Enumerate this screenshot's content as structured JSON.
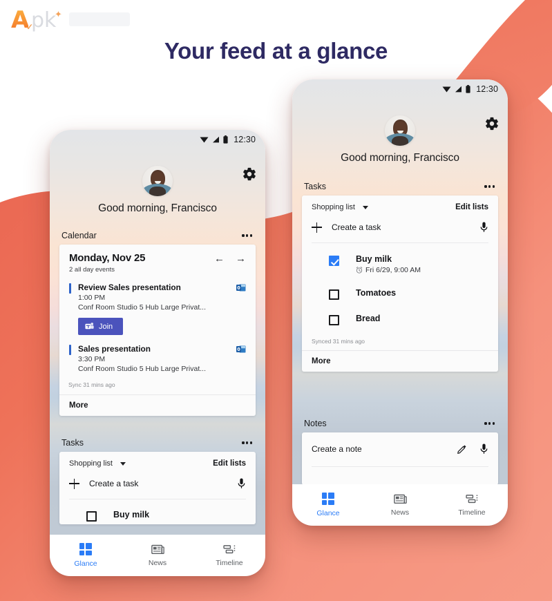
{
  "site": {
    "logo_a": "A",
    "logo_pk": "pk",
    "logo_star": "✦",
    "logo_check": "✓"
  },
  "page": {
    "title": "Your feed at a glance",
    "title_color": "#2e2a63",
    "background_coral": "#ee7259",
    "accent_blue": "#2b7cf6",
    "teams_purple": "#4b53bc",
    "event_bar_blue": "#2e63c9"
  },
  "status_bar": {
    "time": "12:30",
    "wifi_icon": "wifi-icon",
    "signal_icon": "signal-icon",
    "battery_icon": "battery-icon"
  },
  "header": {
    "settings_icon": "gear-icon",
    "avatar_icon": "avatar",
    "greeting": "Good morning, Francisco"
  },
  "left_phone": {
    "calendar_section": {
      "label": "Calendar",
      "overflow_icon": "more-options-icon",
      "date": "Monday, Nov 25",
      "subtitle": "2 all day events",
      "prev_icon": "arrow-left-icon",
      "next_icon": "arrow-right-icon",
      "prev_glyph": "←",
      "next_glyph": "→",
      "events": [
        {
          "title": "Review Sales presentation",
          "time": "1:00 PM",
          "location": "Conf Room Studio 5 Hub Large Privat...",
          "source_icon": "outlook-icon",
          "join_label": "Join",
          "join_icon": "teams-icon"
        },
        {
          "title": "Sales presentation",
          "time": "3:30 PM",
          "location": "Conf Room Studio 5 Hub Large Privat...",
          "source_icon": "outlook-icon"
        }
      ],
      "sync_text": "Sync 31 mins ago",
      "more_label": "More"
    },
    "tasks_section": {
      "label": "Tasks",
      "overflow_icon": "more-options-icon",
      "list_name": "Shopping list",
      "dropdown_icon": "chevron-down-icon",
      "edit_lists_label": "Edit lists",
      "create_task_label": "Create a task",
      "create_icon": "plus-icon",
      "mic_icon": "microphone-icon",
      "peek_item": "Buy milk"
    },
    "bottom_nav": {
      "items": [
        {
          "label": "Glance",
          "icon": "glance-icon",
          "active": true
        },
        {
          "label": "News",
          "icon": "news-icon",
          "active": false
        },
        {
          "label": "Timeline",
          "icon": "timeline-icon",
          "active": false
        }
      ]
    }
  },
  "right_phone": {
    "tasks_section": {
      "label": "Tasks",
      "overflow_icon": "more-options-icon",
      "list_name": "Shopping list",
      "dropdown_icon": "chevron-down-icon",
      "edit_lists_label": "Edit lists",
      "create_task_label": "Create a task",
      "create_icon": "plus-icon",
      "mic_icon": "microphone-icon",
      "items": [
        {
          "label": "Buy milk",
          "checked": true,
          "due": "Fri 6/29, 9:00 AM",
          "due_icon": "alarm-icon"
        },
        {
          "label": "Tomatoes",
          "checked": false,
          "due": ""
        },
        {
          "label": "Bread",
          "checked": false,
          "due": ""
        }
      ],
      "sync_text": "Synced 31 mins ago",
      "more_label": "More"
    },
    "notes_section": {
      "label": "Notes",
      "overflow_icon": "more-options-icon",
      "create_note_placeholder": "Create a note",
      "pencil_icon": "pencil-icon",
      "mic_icon": "microphone-icon"
    },
    "bottom_nav": {
      "items": [
        {
          "label": "Glance",
          "icon": "glance-icon",
          "active": true
        },
        {
          "label": "News",
          "icon": "news-icon",
          "active": false
        },
        {
          "label": "Timeline",
          "icon": "timeline-icon",
          "active": false
        }
      ]
    }
  }
}
